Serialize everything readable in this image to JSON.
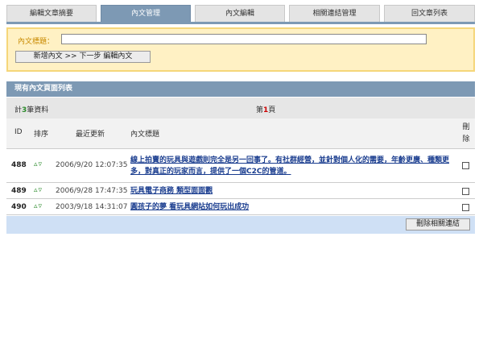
{
  "tabs": [
    {
      "label": "編輯文章摘要"
    },
    {
      "label": "內文管理"
    },
    {
      "label": "內文編輯"
    },
    {
      "label": "相關連結管理"
    },
    {
      "label": "回文章列表"
    }
  ],
  "form": {
    "title_label": "內文標題：",
    "title_value": "",
    "submit_label": "新增內文 >> 下一步 編輯內文"
  },
  "list": {
    "heading": "現有內文頁面列表",
    "count_prefix": "計",
    "count_value": "3",
    "count_suffix": "筆資料",
    "page_prefix": "第",
    "page_value": "1",
    "page_suffix": "頁",
    "columns": {
      "id": "ID",
      "order": "排序",
      "updated": "最近更新",
      "title": "內文標題",
      "delete": "刪除"
    },
    "rows": [
      {
        "id": "488",
        "arrows": "▵▿",
        "date": "2006/9/20 12:07:35",
        "title": "線上拍賣的玩具與遊戲則完全是另一回事了。有社群經營，並針對個人化的需要，年齡更廣、種類更多，對真正的玩家而言，提供了一個C2C的管道。"
      },
      {
        "id": "489",
        "arrows": "▵▿",
        "date": "2006/9/28 17:47:35",
        "title": "玩具電子商務 類型面面觀"
      },
      {
        "id": "490",
        "arrows": "▵▿",
        "date": "2003/9/18 14:31:07",
        "title": "圓孩子的夢 看玩具網站如何玩出成功"
      }
    ],
    "delete_button": "刪除相關連結"
  }
}
